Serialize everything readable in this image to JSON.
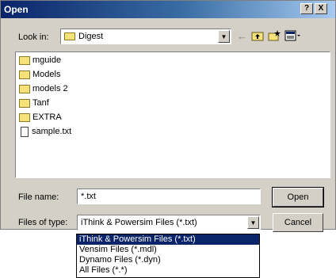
{
  "window": {
    "title": "Open",
    "help_button": "?",
    "close_button": "X"
  },
  "look_in": {
    "label": "Look in:",
    "value": "Digest",
    "icon": "folder-icon"
  },
  "toolbar": {
    "back_icon": "←",
    "up_icon": "up-folder-icon",
    "new_folder_icon": "new-folder-icon",
    "view_menu_icon": "view-menu-icon"
  },
  "files": [
    {
      "name": "mguide",
      "type": "folder"
    },
    {
      "name": "Models",
      "type": "folder"
    },
    {
      "name": "models 2",
      "type": "folder"
    },
    {
      "name": "Tanf",
      "type": "folder"
    },
    {
      "name": "EXTRA",
      "type": "folder"
    },
    {
      "name": "sample.txt",
      "type": "file"
    }
  ],
  "file_name": {
    "label": "File name:",
    "value": "*.txt"
  },
  "files_of_type": {
    "label": "Files of type:",
    "value": "iThink & Powersim Files (*.txt)",
    "options": [
      "iThink & Powersim Files (*.txt)",
      "Vensim Files (*.mdl)",
      "Dynamo Files (*.dyn)",
      "All Files (*.*)"
    ]
  },
  "buttons": {
    "open": "Open",
    "cancel": "Cancel"
  }
}
